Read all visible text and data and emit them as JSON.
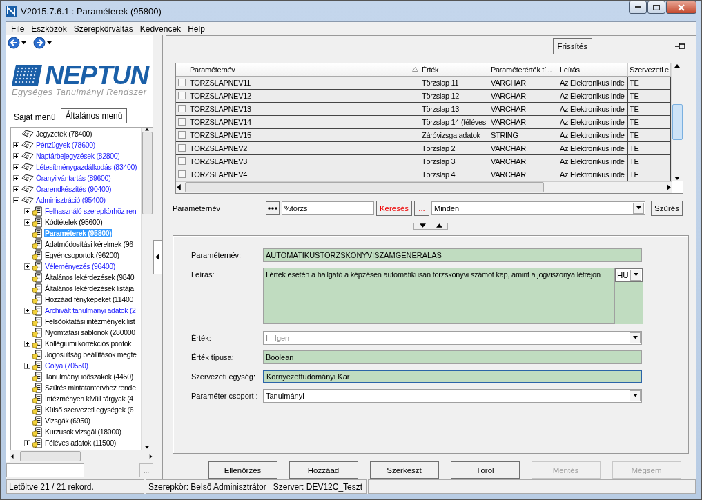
{
  "window": {
    "title": "V2015.7.6.1 : Paraméterek (95800)"
  },
  "menu": [
    "File",
    "Eszközök",
    "Szerepkörváltás",
    "Kedvencek",
    "Help"
  ],
  "logo": {
    "name": "NEPTUN",
    "tagline": "Egységes Tanulmányi Rendszer"
  },
  "menu_tabs": [
    {
      "label": "Saját menü",
      "selected": false
    },
    {
      "label": "Általános menü",
      "selected": true
    }
  ],
  "tree": [
    {
      "label": "Jegyzetek (78400)",
      "expandable": false,
      "expanded": false,
      "linked": false,
      "selected": false
    },
    {
      "label": "Pénzügyek (78600)",
      "expandable": true,
      "expanded": false,
      "linked": true,
      "selected": false
    },
    {
      "label": "Naptárbejegyzések (82800)",
      "expandable": true,
      "expanded": false,
      "linked": true,
      "selected": false
    },
    {
      "label": "Létesítménygazdálkodás (83400)",
      "expandable": true,
      "expanded": false,
      "linked": true,
      "selected": false
    },
    {
      "label": "Óranyilvántartás (89600)",
      "expandable": true,
      "expanded": false,
      "linked": true,
      "selected": false
    },
    {
      "label": "Órarendkészítés (90400)",
      "expandable": true,
      "expanded": false,
      "linked": true,
      "selected": false
    },
    {
      "label": "Adminisztráció (95400)",
      "expandable": true,
      "expanded": true,
      "linked": true,
      "selected": false,
      "children": [
        {
          "label": "Felhasználó szerepkörhöz ren",
          "expandable": true,
          "expanded": false,
          "linked": true,
          "selected": false
        },
        {
          "label": "Kódtételek (95600)",
          "expandable": true,
          "expanded": false,
          "linked": false,
          "selected": false
        },
        {
          "label": "Paraméterek (95800)",
          "expandable": false,
          "expanded": false,
          "linked": false,
          "selected": true
        },
        {
          "label": "Adatmódosítási kérelmek (96",
          "expandable": false,
          "expanded": false,
          "linked": false,
          "selected": false
        },
        {
          "label": "Egyéncsoportok (96200)",
          "expandable": false,
          "expanded": false,
          "linked": false,
          "selected": false
        },
        {
          "label": "Véleményezés (96400)",
          "expandable": true,
          "expanded": false,
          "linked": true,
          "selected": false
        },
        {
          "label": "Általános lekérdezések (9840",
          "expandable": false,
          "expanded": false,
          "linked": false,
          "selected": false
        },
        {
          "label": "Általános lekérdezések listája",
          "expandable": false,
          "expanded": false,
          "linked": false,
          "selected": false
        },
        {
          "label": "Hozzáad fényképeket (11400",
          "expandable": false,
          "expanded": false,
          "linked": false,
          "selected": false
        },
        {
          "label": "Archivált tanulmányi adatok (2",
          "expandable": true,
          "expanded": false,
          "linked": true,
          "selected": false
        },
        {
          "label": "Felsőoktatási intézmények list",
          "expandable": false,
          "expanded": false,
          "linked": false,
          "selected": false
        },
        {
          "label": "Nyomtatási sablonok (280000",
          "expandable": false,
          "expanded": false,
          "linked": false,
          "selected": false
        },
        {
          "label": "Kollégiumi korrekciós pontok",
          "expandable": true,
          "expanded": false,
          "linked": false,
          "selected": false
        },
        {
          "label": "Jogosultság beállítások megte",
          "expandable": false,
          "expanded": false,
          "linked": false,
          "selected": false
        },
        {
          "label": "Gólya (70550)",
          "expandable": true,
          "expanded": false,
          "linked": true,
          "selected": false
        },
        {
          "label": "Tanulmányi időszakok (4450)",
          "expandable": false,
          "expanded": false,
          "linked": false,
          "selected": false
        },
        {
          "label": "Szűrés mintatantervhez rende",
          "expandable": false,
          "expanded": false,
          "linked": false,
          "selected": false
        },
        {
          "label": "Intézményen kívüli tárgyak (4",
          "expandable": false,
          "expanded": false,
          "linked": false,
          "selected": false
        },
        {
          "label": "Külső szervezeti egységek (6",
          "expandable": false,
          "expanded": false,
          "linked": false,
          "selected": false
        },
        {
          "label": "Vizsgák (6950)",
          "expandable": false,
          "expanded": false,
          "linked": false,
          "selected": false
        },
        {
          "label": "Kurzusok vizsgái (18000)",
          "expandable": false,
          "expanded": false,
          "linked": false,
          "selected": false
        },
        {
          "label": "Féléves adatok (11500)",
          "expandable": true,
          "expanded": false,
          "linked": false,
          "selected": false
        }
      ]
    }
  ],
  "tree_search": {
    "button": "..."
  },
  "grid": {
    "refresh": "Frissítés",
    "columns": [
      "Paraméternév",
      "Érték",
      "Paraméterérték tí...",
      "Leírás",
      "Szervezeti e"
    ],
    "rows": [
      {
        "checked": false,
        "cells": [
          "TORZSLAPNEV11",
          "Törzslap 11",
          "VARCHAR",
          "Az Elektronikus inde",
          "TE"
        ]
      },
      {
        "checked": false,
        "cells": [
          "TORZSLAPNEV12",
          "Törzslap 12",
          "VARCHAR",
          "Az Elektronikus inde",
          "TE"
        ]
      },
      {
        "checked": false,
        "cells": [
          "TORZSLAPNEV13",
          "Törzslap 13",
          "VARCHAR",
          "Az Elektronikus inde",
          "TE"
        ]
      },
      {
        "checked": false,
        "cells": [
          "TORZSLAPNEV14",
          "Törzslap 14 (féléves",
          "VARCHAR",
          "Az Elektronikus inde",
          "TE"
        ]
      },
      {
        "checked": false,
        "cells": [
          "TORZSLAPNEV15",
          "Záróvizsga adatok",
          "STRING",
          "Az Elektronikus inde",
          "TE"
        ]
      },
      {
        "checked": false,
        "cells": [
          "TORZSLAPNEV2",
          "Törzslap 2",
          "VARCHAR",
          "Az Elektronikus inde",
          "TE"
        ]
      },
      {
        "checked": false,
        "cells": [
          "TORZSLAPNEV3",
          "Törzslap 3",
          "VARCHAR",
          "Az Elektronikus inde",
          "TE"
        ]
      },
      {
        "checked": false,
        "cells": [
          "TORZSLAPNEV4",
          "Törzslap 4",
          "VARCHAR",
          "Az Elektronikus inde",
          "TE"
        ]
      }
    ]
  },
  "filter": {
    "label": "Paraméternév",
    "value": "%torzs",
    "search": "Keresés",
    "more": "...",
    "scope": "Minden",
    "apply": "Szűrés"
  },
  "form": {
    "fields": [
      {
        "label": "Paraméternév:",
        "value": "AUTOMATIKUSTORZSKONYVISZAMGENERALAS",
        "kind": "text",
        "disabled": false,
        "focused": false
      },
      {
        "label": "Leírás:",
        "value": "I érték esetén a hallgató a képzésen automatikusan törzskönyvi számot kap, amint a jogviszonya létrejön",
        "kind": "textarea",
        "disabled": false,
        "focused": false,
        "language": "HU"
      },
      {
        "label": "Érték:",
        "value": "I - Igen",
        "kind": "select",
        "disabled": true,
        "focused": false
      },
      {
        "label": "Érték típusa:",
        "value": "Boolean",
        "kind": "text",
        "disabled": false,
        "focused": false
      },
      {
        "label": "Szervezeti egység:",
        "value": "Környezettudományi Kar",
        "kind": "text",
        "disabled": false,
        "focused": true
      },
      {
        "label": "Paraméter csoport :",
        "value": "Tanulmányi",
        "kind": "select",
        "disabled": false,
        "focused": false
      }
    ]
  },
  "buttons": [
    {
      "label": "Ellenőrzés",
      "disabled": false
    },
    {
      "label": "Hozzáad",
      "disabled": false
    },
    {
      "label": "Szerkeszt",
      "disabled": false
    },
    {
      "label": "Töröl",
      "disabled": false
    },
    {
      "label": "Mentés",
      "disabled": true
    },
    {
      "label": "Mégsem",
      "disabled": true
    }
  ],
  "status_bar": [
    "Letöltve 21 / 21 rekord.",
    "Szerepkör: Belső Adminisztrátor",
    "Szerver: DEV12C_Teszt"
  ]
}
